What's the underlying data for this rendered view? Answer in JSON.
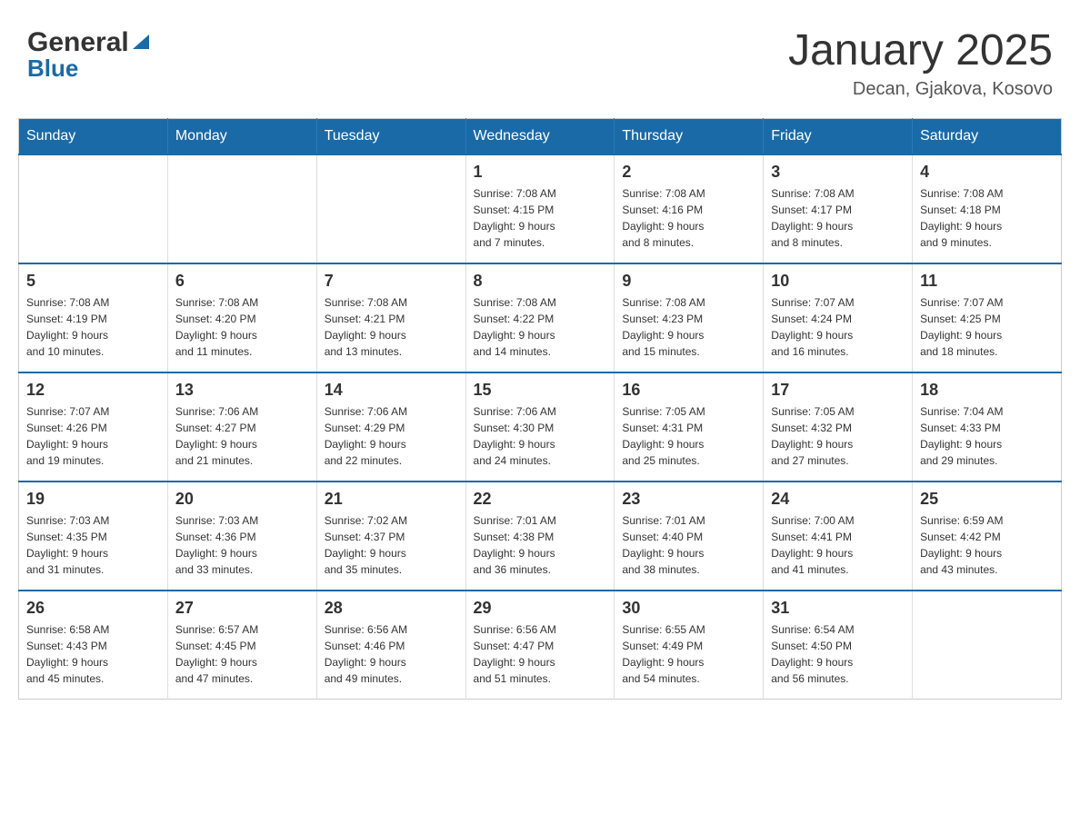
{
  "header": {
    "logo_main": "General",
    "logo_sub": "Blue",
    "month_title": "January 2025",
    "location": "Decan, Gjakova, Kosovo"
  },
  "days_of_week": [
    "Sunday",
    "Monday",
    "Tuesday",
    "Wednesday",
    "Thursday",
    "Friday",
    "Saturday"
  ],
  "weeks": [
    [
      {
        "day": "",
        "info": ""
      },
      {
        "day": "",
        "info": ""
      },
      {
        "day": "",
        "info": ""
      },
      {
        "day": "1",
        "info": "Sunrise: 7:08 AM\nSunset: 4:15 PM\nDaylight: 9 hours\nand 7 minutes."
      },
      {
        "day": "2",
        "info": "Sunrise: 7:08 AM\nSunset: 4:16 PM\nDaylight: 9 hours\nand 8 minutes."
      },
      {
        "day": "3",
        "info": "Sunrise: 7:08 AM\nSunset: 4:17 PM\nDaylight: 9 hours\nand 8 minutes."
      },
      {
        "day": "4",
        "info": "Sunrise: 7:08 AM\nSunset: 4:18 PM\nDaylight: 9 hours\nand 9 minutes."
      }
    ],
    [
      {
        "day": "5",
        "info": "Sunrise: 7:08 AM\nSunset: 4:19 PM\nDaylight: 9 hours\nand 10 minutes."
      },
      {
        "day": "6",
        "info": "Sunrise: 7:08 AM\nSunset: 4:20 PM\nDaylight: 9 hours\nand 11 minutes."
      },
      {
        "day": "7",
        "info": "Sunrise: 7:08 AM\nSunset: 4:21 PM\nDaylight: 9 hours\nand 13 minutes."
      },
      {
        "day": "8",
        "info": "Sunrise: 7:08 AM\nSunset: 4:22 PM\nDaylight: 9 hours\nand 14 minutes."
      },
      {
        "day": "9",
        "info": "Sunrise: 7:08 AM\nSunset: 4:23 PM\nDaylight: 9 hours\nand 15 minutes."
      },
      {
        "day": "10",
        "info": "Sunrise: 7:07 AM\nSunset: 4:24 PM\nDaylight: 9 hours\nand 16 minutes."
      },
      {
        "day": "11",
        "info": "Sunrise: 7:07 AM\nSunset: 4:25 PM\nDaylight: 9 hours\nand 18 minutes."
      }
    ],
    [
      {
        "day": "12",
        "info": "Sunrise: 7:07 AM\nSunset: 4:26 PM\nDaylight: 9 hours\nand 19 minutes."
      },
      {
        "day": "13",
        "info": "Sunrise: 7:06 AM\nSunset: 4:27 PM\nDaylight: 9 hours\nand 21 minutes."
      },
      {
        "day": "14",
        "info": "Sunrise: 7:06 AM\nSunset: 4:29 PM\nDaylight: 9 hours\nand 22 minutes."
      },
      {
        "day": "15",
        "info": "Sunrise: 7:06 AM\nSunset: 4:30 PM\nDaylight: 9 hours\nand 24 minutes."
      },
      {
        "day": "16",
        "info": "Sunrise: 7:05 AM\nSunset: 4:31 PM\nDaylight: 9 hours\nand 25 minutes."
      },
      {
        "day": "17",
        "info": "Sunrise: 7:05 AM\nSunset: 4:32 PM\nDaylight: 9 hours\nand 27 minutes."
      },
      {
        "day": "18",
        "info": "Sunrise: 7:04 AM\nSunset: 4:33 PM\nDaylight: 9 hours\nand 29 minutes."
      }
    ],
    [
      {
        "day": "19",
        "info": "Sunrise: 7:03 AM\nSunset: 4:35 PM\nDaylight: 9 hours\nand 31 minutes."
      },
      {
        "day": "20",
        "info": "Sunrise: 7:03 AM\nSunset: 4:36 PM\nDaylight: 9 hours\nand 33 minutes."
      },
      {
        "day": "21",
        "info": "Sunrise: 7:02 AM\nSunset: 4:37 PM\nDaylight: 9 hours\nand 35 minutes."
      },
      {
        "day": "22",
        "info": "Sunrise: 7:01 AM\nSunset: 4:38 PM\nDaylight: 9 hours\nand 36 minutes."
      },
      {
        "day": "23",
        "info": "Sunrise: 7:01 AM\nSunset: 4:40 PM\nDaylight: 9 hours\nand 38 minutes."
      },
      {
        "day": "24",
        "info": "Sunrise: 7:00 AM\nSunset: 4:41 PM\nDaylight: 9 hours\nand 41 minutes."
      },
      {
        "day": "25",
        "info": "Sunrise: 6:59 AM\nSunset: 4:42 PM\nDaylight: 9 hours\nand 43 minutes."
      }
    ],
    [
      {
        "day": "26",
        "info": "Sunrise: 6:58 AM\nSunset: 4:43 PM\nDaylight: 9 hours\nand 45 minutes."
      },
      {
        "day": "27",
        "info": "Sunrise: 6:57 AM\nSunset: 4:45 PM\nDaylight: 9 hours\nand 47 minutes."
      },
      {
        "day": "28",
        "info": "Sunrise: 6:56 AM\nSunset: 4:46 PM\nDaylight: 9 hours\nand 49 minutes."
      },
      {
        "day": "29",
        "info": "Sunrise: 6:56 AM\nSunset: 4:47 PM\nDaylight: 9 hours\nand 51 minutes."
      },
      {
        "day": "30",
        "info": "Sunrise: 6:55 AM\nSunset: 4:49 PM\nDaylight: 9 hours\nand 54 minutes."
      },
      {
        "day": "31",
        "info": "Sunrise: 6:54 AM\nSunset: 4:50 PM\nDaylight: 9 hours\nand 56 minutes."
      },
      {
        "day": "",
        "info": ""
      }
    ]
  ]
}
